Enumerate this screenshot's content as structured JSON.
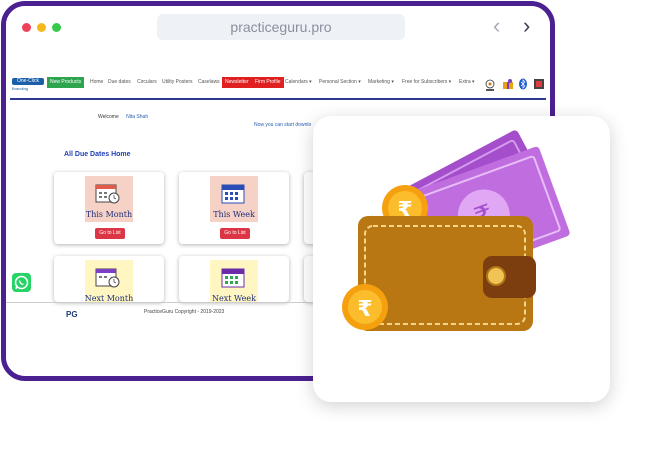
{
  "browser": {
    "url": "practiceguru.pro",
    "frame_color": "#4b2192"
  },
  "topbar": {
    "logo_line1": "One-Click",
    "logo_line2": "Branding",
    "new_products": "New Products",
    "links": [
      "Home",
      "Due dates",
      "Circulars",
      "Utility Posters",
      "Caselaws"
    ],
    "newsletter": "Newsletter",
    "firm_profile": "Firm Profile",
    "menus": [
      "Calendars ▾",
      "Personal Section ▾",
      "Marketing ▾",
      "Free for Subscribers ▾",
      "Extra ▾"
    ]
  },
  "welcome": {
    "label": "Welcome",
    "name": "Nita Shah"
  },
  "notice": "Now you can start downlo",
  "heading": "All Due Dates Home",
  "cards": [
    {
      "label": "This Month",
      "button": "Go to List",
      "icon": "calendar-clock-icon"
    },
    {
      "label": "This Week",
      "button": "Go to List",
      "icon": "calendar-grid-icon"
    },
    {
      "label": "Next Month",
      "icon": "calendar-clock-icon"
    },
    {
      "label": "Next Week",
      "icon": "calendar-grid-icon"
    }
  ],
  "footer": {
    "copyright": "PracticeGuru Copyright - 2019-2023",
    "logo": "PG"
  },
  "illustration": {
    "icon": "wallet-with-rupee-icon",
    "currency_symbol": "₹"
  }
}
